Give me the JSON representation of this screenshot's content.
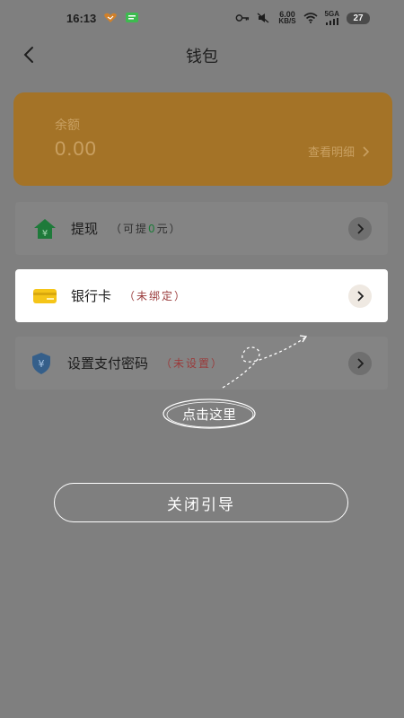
{
  "status_bar": {
    "time": "16:13",
    "speed_value": "6.00",
    "speed_unit": "KB/S",
    "network": "5GA",
    "battery": "27"
  },
  "header": {
    "title": "钱包"
  },
  "balance": {
    "label": "余额",
    "amount": "0.00",
    "detail_link": "查看明细"
  },
  "menu": {
    "withdraw": {
      "title": "提现",
      "note_prefix": "（可提",
      "note_value": "0",
      "note_suffix": "元）"
    },
    "bank_card": {
      "title": "银行卡",
      "note": "（未绑定）"
    },
    "pay_password": {
      "title": "设置支付密码",
      "note": "（未设置）"
    }
  },
  "guide": {
    "hint": "点击这里",
    "close_label": "关闭引导"
  },
  "colors": {
    "overlay": "#7f7f7f",
    "card_gold": "#a47327",
    "accent_green": "#1e7a3a",
    "accent_red": "#9a3b3b"
  }
}
